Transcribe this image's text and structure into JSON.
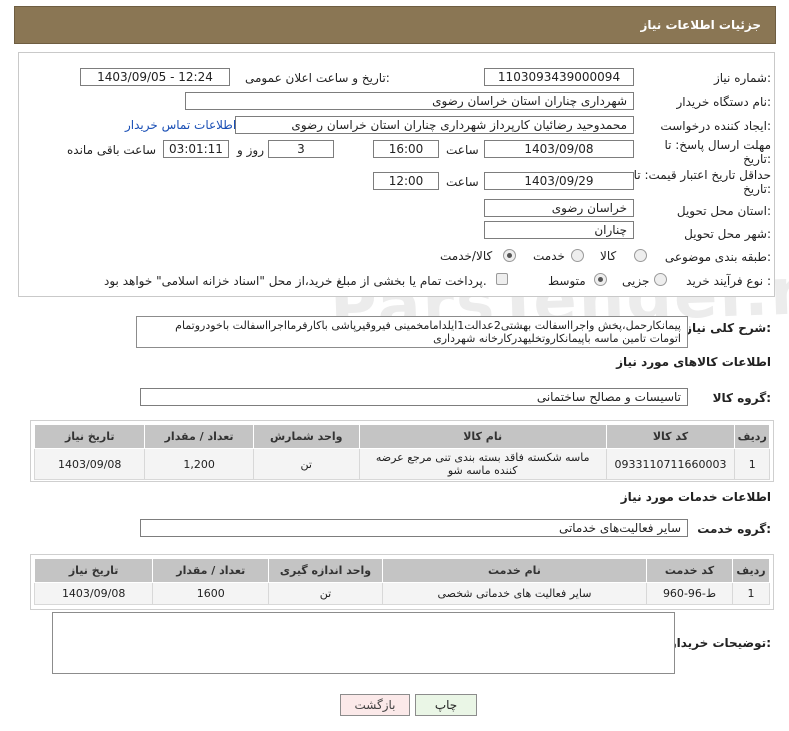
{
  "header": {
    "title": "جزئیات اطلاعات نیاز"
  },
  "watermark": "ParsTender.net",
  "form": {
    "need_number_label": "شماره نیاز:",
    "need_number": "1103093439000094",
    "announce_label": "تاریخ و ساعت اعلان عمومی:",
    "announce_value": "1403/09/05 - 12:24",
    "buyer_label": "نام دستگاه خریدار:",
    "buyer_value": "شهرداری چناران استان خراسان رضوی",
    "requester_label": "ایجاد کننده درخواست:",
    "requester_value": "محمدوحید رضائیان کارپرداز شهرداری چناران استان خراسان رضوی",
    "contact_link": "اطلاعات تماس خریدار",
    "deadline_label_1": "مهلت ارسال پاسخ: تا",
    "deadline_label_2": "تاریخ:",
    "deadline_date": "1403/09/08",
    "time_label": "ساعت",
    "deadline_time": "16:00",
    "days_value": "3",
    "days_label": "روز و",
    "remaining_value": "03:01:11",
    "remaining_label": "ساعت باقی مانده",
    "validity_label_1": "حداقل تاریخ اعتبار قیمت: تا",
    "validity_label_2": "تاریخ:",
    "validity_date": "1403/09/29",
    "validity_time": "12:00",
    "province_label": "استان محل تحویل:",
    "province_value": "خراسان رضوی",
    "city_label": "شهر محل تحویل:",
    "city_value": "چناران",
    "category_label": "طبقه بندی موضوعی:",
    "category_options": [
      "کالا",
      "خدمت",
      "کالا/خدمت"
    ],
    "category_selected": "کالا/خدمت",
    "process_label": "نوع فرآیند خرید :",
    "process_options": [
      "جزیی",
      "متوسط"
    ],
    "payment_note": "پرداخت تمام یا بخشی از مبلغ خرید،از محل \"اسناد خزانه اسلامی\" خواهد بود."
  },
  "description": {
    "label": "شرح کلی نیاز:",
    "text": "پیمانکارحمل،پخش واجرااسفالت بهشتی2عدالت1ایلدامامخمینی فیروقیرپاشی باکارفرمااجرااسفالت باخودروتمام اتومات تامین ماسه باپیمانکاروتخلیهدرکارخانه شهرداری"
  },
  "goods": {
    "section_title": "اطلاعات کالاهای مورد نیاز",
    "group_label": "گروه کالا:",
    "group_value": "تاسیسات و مصالح ساختمانی",
    "columns": [
      "ردیف",
      "کد کالا",
      "نام کالا",
      "واحد شمارش",
      "تعداد / مقدار",
      "تاریخ نیاز"
    ],
    "rows": [
      [
        "1",
        "0933110711660003",
        "ماسه شکسته فاقد بسته بندی تنی مرجع عرضه کننده ماسه شو",
        "تن",
        "1,200",
        "1403/09/08"
      ]
    ]
  },
  "services": {
    "section_title": "اطلاعات خدمات مورد نیاز",
    "group_label": "گروه خدمت:",
    "group_value": "سایر فعالیت‌های خدماتی",
    "columns": [
      "ردیف",
      "کد خدمت",
      "نام خدمت",
      "واحد اندازه گیری",
      "تعداد / مقدار",
      "تاریخ نیاز"
    ],
    "rows": [
      [
        "1",
        "ط-96-960",
        "سایر فعالیت های خدماتی شخصی",
        "تن",
        "1600",
        "1403/09/08"
      ]
    ]
  },
  "buyer_notes": {
    "label": "توضیحات خریدار:",
    "value": ""
  },
  "buttons": {
    "print": "چاپ",
    "back": "بازگشت"
  },
  "colors": {
    "header": "#8a7654",
    "link": "#1a4fb5"
  }
}
